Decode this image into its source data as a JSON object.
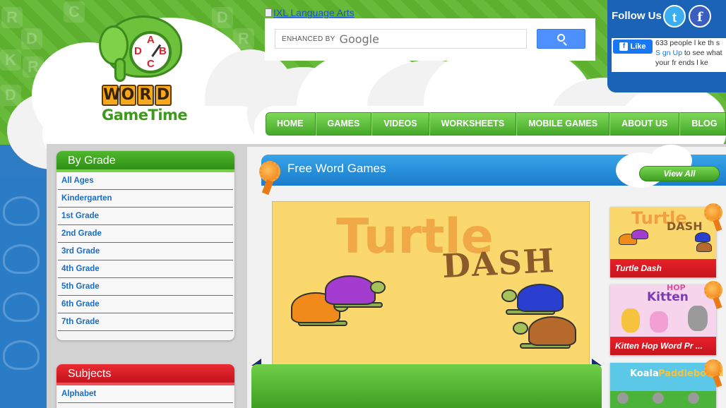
{
  "logo": {
    "clock_letters": [
      "A",
      "B",
      "C",
      "D"
    ],
    "word_letters": [
      "W",
      "O",
      "R",
      "D"
    ],
    "subtitle": "GameTime"
  },
  "banner": {
    "ixl_link": "IXL Language Arts"
  },
  "search": {
    "enhanced_label": "ENHANCED BY",
    "google_word": "Google"
  },
  "follow": {
    "title": "Follow Us",
    "twitter_icon": "twitter-icon",
    "facebook_icon": "facebook-icon",
    "like_label": "Like",
    "like_count_text": "633 people l ke th s",
    "signup_text": "S gn Up",
    "signup_suffix": " to see what your fr ends l ke"
  },
  "nav": {
    "items": [
      "HOME",
      "GAMES",
      "VIDEOS",
      "WORKSHEETS",
      "MOBILE GAMES",
      "ABOUT US",
      "BLOG"
    ]
  },
  "by_grade": {
    "title": "By Grade",
    "items": [
      "All Ages",
      "Kindergarten",
      "1st Grade",
      "2nd Grade",
      "3rd Grade",
      "4th Grade",
      "5th Grade",
      "6th Grade",
      "7th Grade"
    ]
  },
  "subjects": {
    "title": "Subjects",
    "items": [
      "Alphabet"
    ]
  },
  "free_games": {
    "title": "Free Word Games",
    "view_all": "View All",
    "featured": {
      "title_word": "Turtle",
      "title_word2": "DASH"
    },
    "thumbnails": [
      {
        "label": "Turtle Dash",
        "art_title": "Turtle",
        "art_title2": "DASH"
      },
      {
        "label": "Kitten Hop Word Pr ...",
        "art_title": "Kitten",
        "art_title2": "HOP"
      },
      {
        "label": "",
        "art_title": "Koala",
        "art_title2": "Paddleboard"
      }
    ]
  },
  "colors": {
    "green": "#5fb62e",
    "blue": "#1b7ccc",
    "red": "#d81c24",
    "link": "#1a6cc4"
  }
}
